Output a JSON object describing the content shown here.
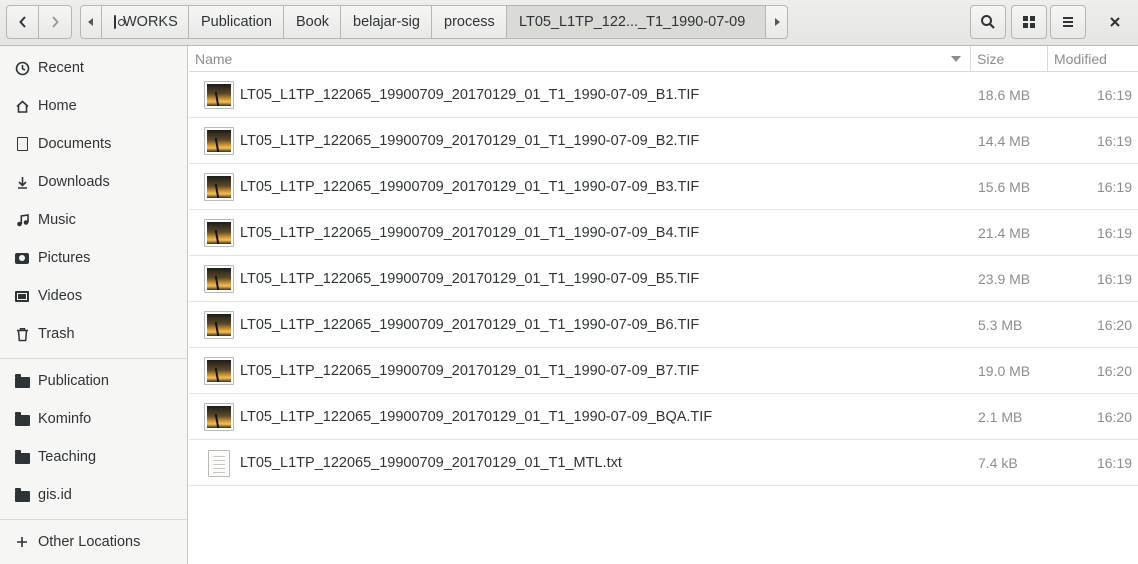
{
  "header": {
    "back_label": "back",
    "forward_label": "forward",
    "path": [
      "WORKS",
      "Publication",
      "Book",
      "belajar-sig",
      "process",
      "LT05_L1TP_122..._T1_1990-07-09"
    ],
    "search_label": "search",
    "view_label": "view",
    "menu_label": "menu",
    "close_label": "close"
  },
  "sidebar": {
    "places": [
      {
        "label": "Recent",
        "icon": "clock-icon"
      },
      {
        "label": "Home",
        "icon": "home-icon"
      },
      {
        "label": "Documents",
        "icon": "document-icon"
      },
      {
        "label": "Downloads",
        "icon": "download-icon"
      },
      {
        "label": "Music",
        "icon": "music-icon"
      },
      {
        "label": "Pictures",
        "icon": "camera-icon"
      },
      {
        "label": "Videos",
        "icon": "film-icon"
      },
      {
        "label": "Trash",
        "icon": "trash-icon"
      }
    ],
    "bookmarks": [
      {
        "label": "Publication",
        "icon": "folder-icon"
      },
      {
        "label": "Kominfo",
        "icon": "folder-icon"
      },
      {
        "label": "Teaching",
        "icon": "folder-icon"
      },
      {
        "label": "gis.id",
        "icon": "folder-icon"
      }
    ],
    "other_locations": "Other Locations"
  },
  "columns": {
    "name": "Name",
    "size": "Size",
    "modified": "Modified"
  },
  "files": [
    {
      "name": "LT05_L1TP_122065_19900709_20170129_01_T1_1990-07-09_B1.TIF",
      "size": "18.6 MB",
      "modified": "16:19",
      "type": "image"
    },
    {
      "name": "LT05_L1TP_122065_19900709_20170129_01_T1_1990-07-09_B2.TIF",
      "size": "14.4 MB",
      "modified": "16:19",
      "type": "image"
    },
    {
      "name": "LT05_L1TP_122065_19900709_20170129_01_T1_1990-07-09_B3.TIF",
      "size": "15.6 MB",
      "modified": "16:19",
      "type": "image"
    },
    {
      "name": "LT05_L1TP_122065_19900709_20170129_01_T1_1990-07-09_B4.TIF",
      "size": "21.4 MB",
      "modified": "16:19",
      "type": "image"
    },
    {
      "name": "LT05_L1TP_122065_19900709_20170129_01_T1_1990-07-09_B5.TIF",
      "size": "23.9 MB",
      "modified": "16:19",
      "type": "image"
    },
    {
      "name": "LT05_L1TP_122065_19900709_20170129_01_T1_1990-07-09_B6.TIF",
      "size": "5.3 MB",
      "modified": "16:20",
      "type": "image"
    },
    {
      "name": "LT05_L1TP_122065_19900709_20170129_01_T1_1990-07-09_B7.TIF",
      "size": "19.0 MB",
      "modified": "16:20",
      "type": "image"
    },
    {
      "name": "LT05_L1TP_122065_19900709_20170129_01_T1_1990-07-09_BQA.TIF",
      "size": "2.1 MB",
      "modified": "16:20",
      "type": "image"
    },
    {
      "name": "LT05_L1TP_122065_19900709_20170129_01_T1_MTL.txt",
      "size": "7.4 kB",
      "modified": "16:19",
      "type": "text"
    }
  ]
}
